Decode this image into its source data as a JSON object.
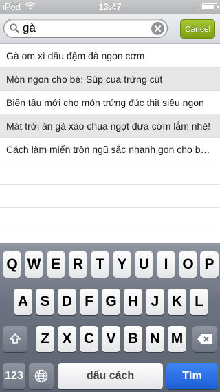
{
  "status_bar": {
    "device": "iPod",
    "time": "13:47",
    "battery_level": 0.85
  },
  "search": {
    "query": "gà",
    "cancel_label": "Cancel"
  },
  "results": [
    "Gà om xì dầu đậm đà ngon cơm",
    "Món ngon cho bé: Súp cua trứng cút",
    "Biến tấu mới cho món trứng đúc thịt siêu ngon",
    "Mát trời ăn gà xào chua ngọt đưa cơm lắm nhé!",
    "Cách làm miến trộn ngũ sắc nhanh gọn cho bữa trưa"
  ],
  "keyboard": {
    "row1": [
      "Q",
      "W",
      "E",
      "R",
      "T",
      "Y",
      "U",
      "I",
      "O",
      "P"
    ],
    "row2": [
      "A",
      "S",
      "D",
      "F",
      "G",
      "H",
      "J",
      "K",
      "L"
    ],
    "row3": [
      "Z",
      "X",
      "C",
      "V",
      "B",
      "N",
      "M"
    ],
    "numbers_label": "123",
    "space_label": "dấu cách",
    "go_label": "Tìm",
    "icons": {
      "shift": "shift-icon",
      "delete": "delete-icon",
      "globe": "globe-icon"
    }
  }
}
